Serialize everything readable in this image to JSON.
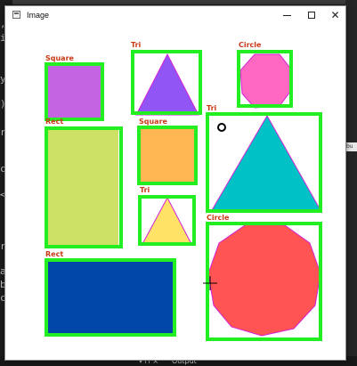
{
  "window": {
    "title": "Image",
    "minimize_glyph": "minimize-icon",
    "maximize_glyph": "maximize-icon",
    "close_glyph": "✕"
  },
  "background": {
    "top_right_text": "y",
    "bottom_text_left": "▾ ⊓ ×",
    "bottom_text_right": "Output",
    "right_edge_text": "bu",
    "left_code_lines": [
      ",",
      "ij",
      "y|",
      ");",
      "ri",
      "ct",
      "<",
      "rc",
      "ar",
      "bo",
      "ct"
    ]
  },
  "shapes": [
    {
      "label": "Square",
      "kind": "square",
      "color": "#c464e3"
    },
    {
      "label": "Tri",
      "kind": "triangle",
      "color": "#9255f5"
    },
    {
      "label": "Circle",
      "kind": "octagon",
      "color": "#ff67c2"
    },
    {
      "label": "Rect",
      "kind": "rect",
      "color": "#cce165"
    },
    {
      "label": "Square",
      "kind": "square",
      "color": "#feb753"
    },
    {
      "label": "Tri",
      "kind": "triangle",
      "color": "#00c2c6"
    },
    {
      "label": "Tri",
      "kind": "triangle",
      "color": "#ffe266"
    },
    {
      "label": "Circle",
      "kind": "polygon",
      "color": "#ff5453"
    },
    {
      "label": "Rect",
      "kind": "rect",
      "color": "#0045a8"
    }
  ],
  "cursor": "crosshair-cursor"
}
